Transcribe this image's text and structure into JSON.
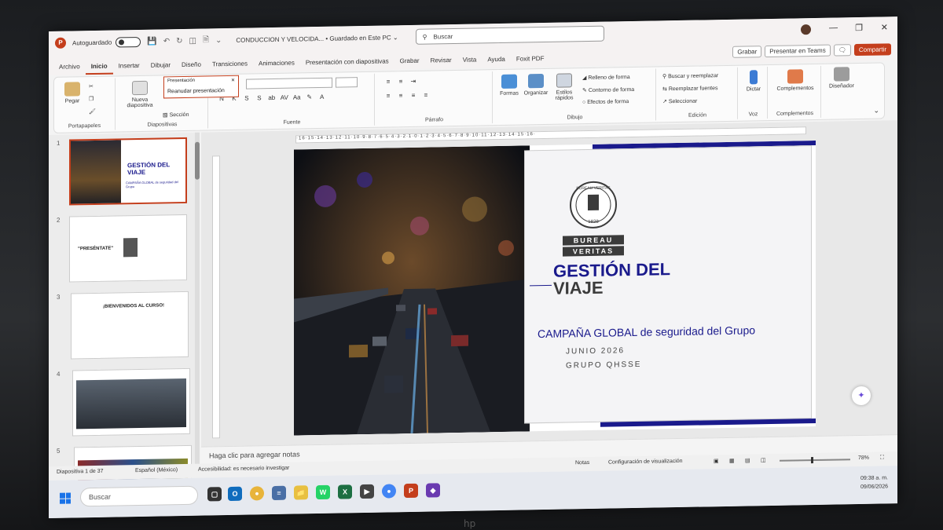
{
  "titlebar": {
    "autosave": "Autoguardado",
    "doc_title": "CONDUCCION Y VELOCIDA... • Guardado en Este PC ⌄",
    "search_placeholder": "Buscar"
  },
  "tabs": [
    "Archivo",
    "Inicio",
    "Insertar",
    "Dibujar",
    "Diseño",
    "Transiciones",
    "Animaciones",
    "Presentación con diapositivas",
    "Grabar",
    "Revisar",
    "Vista",
    "Ayuda",
    "Foxit PDF"
  ],
  "active_tab": "Inicio",
  "right_tools": {
    "grabar": "Grabar",
    "present_teams": "Presentar en Teams",
    "share": "Compartir"
  },
  "ribbon": {
    "portapapeles": {
      "label": "Portapapeles",
      "paste": "Pegar"
    },
    "diapositivas": {
      "label": "Diapositivas",
      "new_slide": "Nueva diapositiva",
      "section": "Sección"
    },
    "fuente": {
      "label": "Fuente"
    },
    "parrafo": {
      "label": "Párrafo"
    },
    "dibujo": {
      "label": "Dibujo",
      "shapes": "Formas",
      "arrange": "Organizar",
      "quick_styles": "Estilos rápidos",
      "fill": "Relleno de forma",
      "outline": "Contorno de forma",
      "effects": "Efectos de forma"
    },
    "edicion": {
      "label": "Edición",
      "find_replace": "Buscar y reemplazar",
      "replace_fonts": "Reemplazar fuentes",
      "select": "Seleccionar"
    },
    "voz": {
      "label": "Voz",
      "dictate": "Dictar"
    },
    "complementos": {
      "label": "Complementos",
      "addins": "Complementos"
    },
    "designer": "Diseñador"
  },
  "tooltip": {
    "header": "Presentación",
    "item": "Reanudar presentación"
  },
  "thumbnails": [
    {
      "num": "1",
      "title": "GESTIÓN DEL VIAJE",
      "sub": "CAMPAÑA GLOBAL de seguridad del Grupo"
    },
    {
      "num": "2",
      "title": "\"PRESÉNTATE\""
    },
    {
      "num": "3",
      "title": "¡BIENVENIDOS AL CURSO!"
    },
    {
      "num": "4",
      "title": ""
    },
    {
      "num": "5",
      "title": ""
    }
  ],
  "ruler_text": "·16·15·14·13·12·11·10·9·8·7·6·5·4·3·2·1·0·1·2·3·4·5·6·7·8·9·10·11·12·13·14·15·16·",
  "slide": {
    "brand_top": "BUREAU",
    "brand_bottom": "VERITAS",
    "seal_top": "BUREAU VERITAS",
    "seal_year": "1828",
    "title_line1": "GESTIÓN DEL",
    "title_line2": "VIAJE",
    "campaign": "CAMPAÑA GLOBAL de seguridad del Grupo",
    "date": "JUNIO 2026",
    "group": "GRUPO QHSSE"
  },
  "notes_placeholder": "Haga clic para agregar notas",
  "statusbar": {
    "slide_counter": "Diapositiva 1 de 37",
    "language": "Español (México)",
    "accessibility": "Accesibilidad: es necesario investigar",
    "notes": "Notas",
    "display_settings": "Configuración de visualización",
    "zoom": "78%"
  },
  "taskbar": {
    "search": "Buscar",
    "time": "09:38 a. m.",
    "date": "09/06/2026"
  },
  "colors": {
    "accent": "#c43e1c",
    "brand_blue": "#1a1a8c",
    "brand_gray": "#3b3b3b"
  }
}
